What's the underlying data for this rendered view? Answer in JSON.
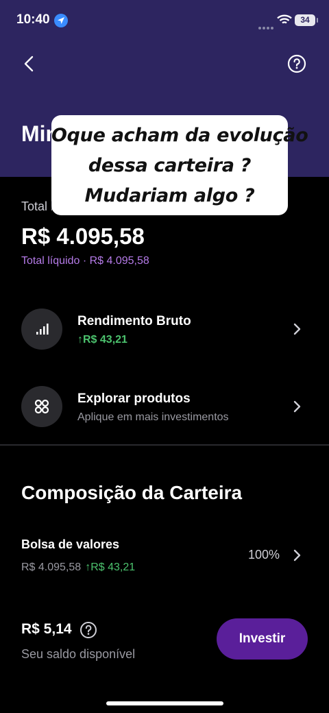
{
  "status_bar": {
    "time": "10:40",
    "battery": "34"
  },
  "header": {
    "title": "Minha Carteira"
  },
  "overlay": {
    "lines": [
      "Oque acham da evolução",
      "dessa carteira ?",
      "Mudariam algo ?"
    ]
  },
  "summary": {
    "total_label": "Total bruto",
    "total_value": "R$ 4.095,58",
    "net_line": "Total líquido · R$ 4.095,58"
  },
  "rows": [
    {
      "title": "Rendimento Bruto",
      "subtitle": "↑R$ 43,21",
      "icon": "signal-bars-icon"
    },
    {
      "title": "Explorar produtos",
      "subtitle": "Aplique em mais investimentos",
      "icon": "grid-dots-icon"
    }
  ],
  "composition": {
    "title": "Composição da Carteira",
    "asset_name": "Bolsa de valores",
    "asset_value": "R$ 4.095,58",
    "asset_gain": "↑R$ 43,21",
    "asset_percent": "100%"
  },
  "footer": {
    "balance_value": "R$ 5,14",
    "balance_label": "Seu saldo disponível",
    "invest_label": "Investir"
  },
  "colors": {
    "header_bg": "#2d2560",
    "accent": "#5a1f9a",
    "positive": "#4cc36e",
    "net_text": "#b57be8"
  }
}
